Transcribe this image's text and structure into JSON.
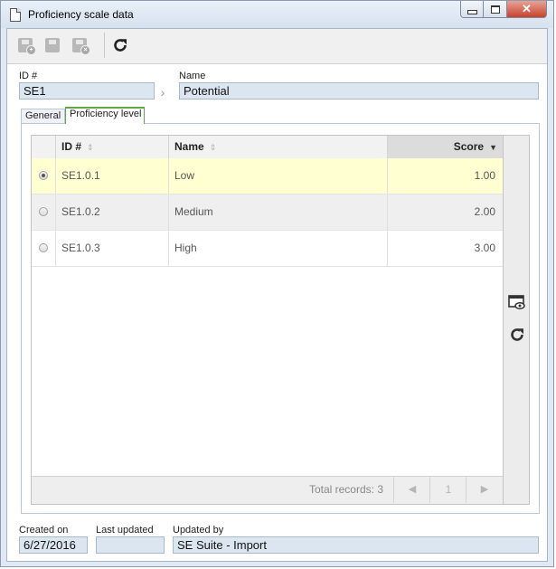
{
  "window": {
    "title": "Proficiency scale data"
  },
  "toolbar": {
    "save_new_icon": "save-new-icon",
    "save_icon": "save-icon",
    "save_close_icon": "save-close-icon",
    "refresh_icon": "refresh-icon"
  },
  "header": {
    "id_label": "ID #",
    "id_value": "SE1",
    "name_label": "Name",
    "name_value": "Potential"
  },
  "tabs": [
    {
      "label": "General",
      "active": false
    },
    {
      "label": "Proficiency level",
      "active": true
    }
  ],
  "table": {
    "columns": [
      {
        "label": "ID #",
        "sort": "⇕"
      },
      {
        "label": "Name",
        "sort": "⇕"
      },
      {
        "label": "Score",
        "sort": "▼"
      }
    ],
    "rows": [
      {
        "id": "SE1.0.1",
        "name": "Low",
        "score": "1.00",
        "selected": true
      },
      {
        "id": "SE1.0.2",
        "name": "Medium",
        "score": "2.00",
        "selected": false
      },
      {
        "id": "SE1.0.3",
        "name": "High",
        "score": "3.00",
        "selected": false
      }
    ],
    "footer": {
      "total_text": "Total records: 3",
      "prev": "◀",
      "page": "1",
      "next": "▶"
    }
  },
  "footer": {
    "created_label": "Created on",
    "created_value": "6/27/2016",
    "updated_label": "Last updated",
    "updated_value": "",
    "updated_by_label": "Updated by",
    "updated_by_value": "SE Suite - Import"
  },
  "colors": {
    "selected_row": "#ffffd2",
    "alt_row": "#efefef",
    "active_tab_border": "#5fa84a",
    "field_bg": "#dce6f1"
  }
}
